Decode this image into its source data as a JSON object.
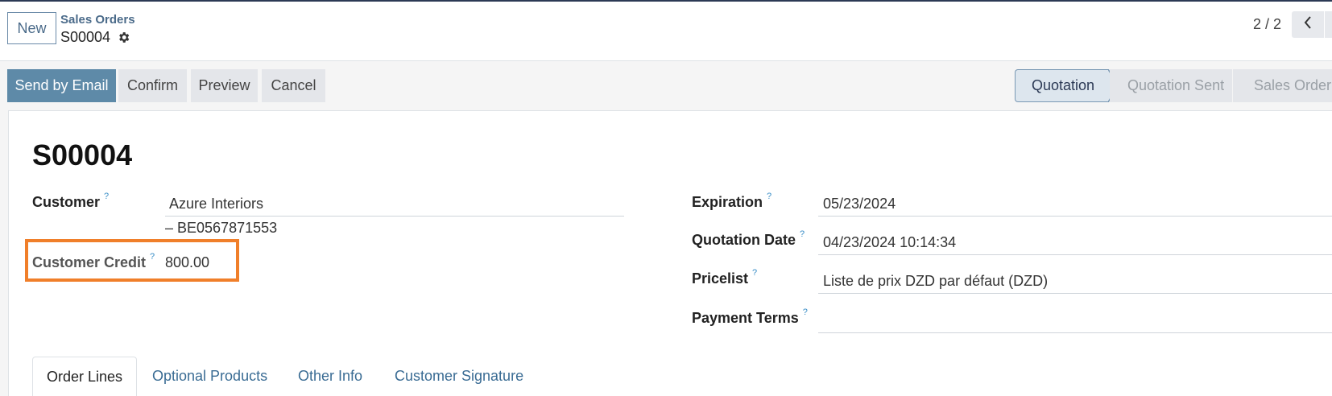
{
  "header": {
    "new_label": "New",
    "breadcrumb_parent": "Sales Orders",
    "breadcrumb_current": "S00004",
    "pager": "2 / 2"
  },
  "actions": {
    "send_email": "Send by Email",
    "confirm": "Confirm",
    "preview": "Preview",
    "cancel": "Cancel"
  },
  "statusbar": {
    "steps": [
      "Quotation",
      "Quotation Sent",
      "Sales Order"
    ],
    "active": "Quotation"
  },
  "form": {
    "name": "S00004",
    "help_mark": "?",
    "left": {
      "customer_label": "Customer",
      "customer_value": "Azure Interiors",
      "customer_vat": "– BE0567871553",
      "credit_label": "Customer Credit",
      "credit_value": "800.00"
    },
    "right": {
      "expiration_label": "Expiration",
      "expiration_value": "05/23/2024",
      "quotation_date_label": "Quotation Date",
      "quotation_date_value": "04/23/2024 10:14:34",
      "pricelist_label": "Pricelist",
      "pricelist_value": "Liste de prix DZD par défaut (DZD)",
      "payment_terms_label": "Payment Terms",
      "payment_terms_value": ""
    }
  },
  "tabs": [
    "Order Lines",
    "Optional Products",
    "Other Info",
    "Customer Signature"
  ],
  "colors": {
    "primary": "#5e8aa8",
    "highlight_box": "#f07f2a",
    "help_mark": "#3a8ec7"
  }
}
